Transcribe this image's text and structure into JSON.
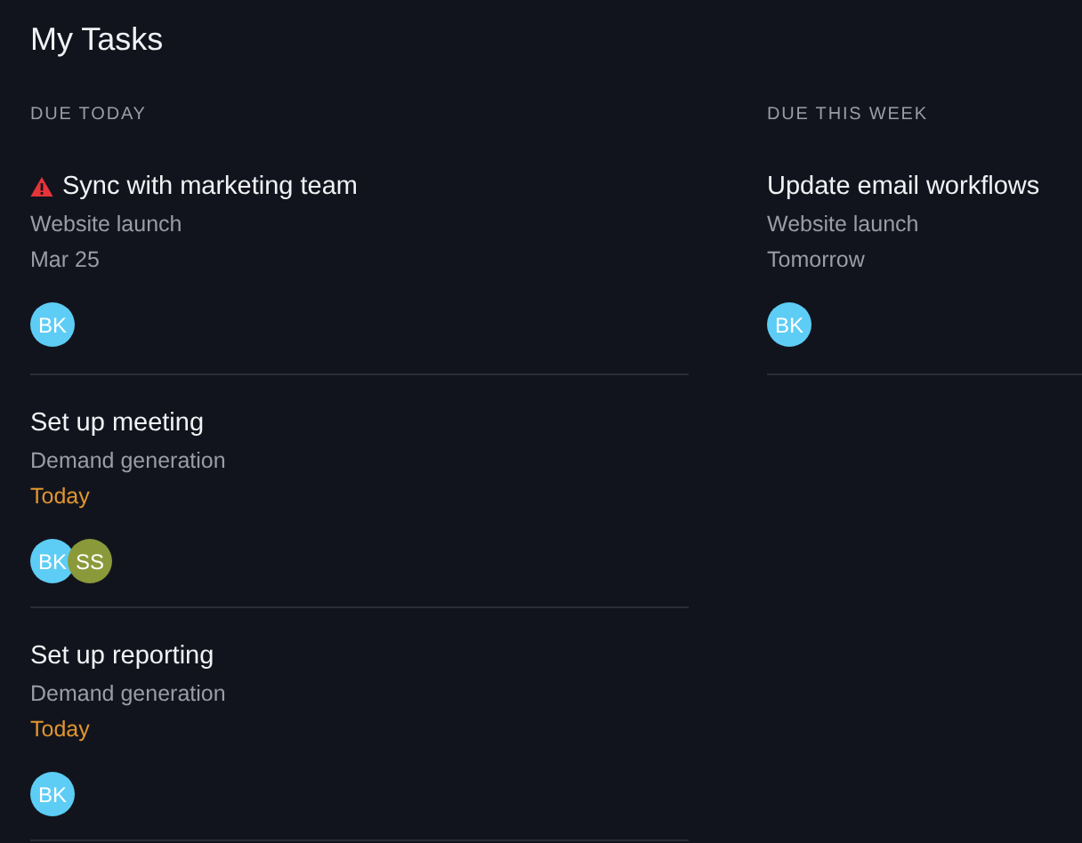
{
  "title": "My Tasks",
  "sections": [
    {
      "heading": "DUE TODAY",
      "tasks": [
        {
          "title": "Sync with marketing team",
          "warning": true,
          "project": "Website launch",
          "due": "Mar 25",
          "due_today": false,
          "assignees": [
            {
              "initials": "BK",
              "color": "#5dcdf5"
            }
          ]
        },
        {
          "title": "Set up meeting",
          "warning": false,
          "project": "Demand generation",
          "due": "Today",
          "due_today": true,
          "assignees": [
            {
              "initials": "BK",
              "color": "#5dcdf5"
            },
            {
              "initials": "SS",
              "color": "#8a9a3a"
            }
          ]
        },
        {
          "title": "Set up reporting",
          "warning": false,
          "project": "Demand generation",
          "due": "Today",
          "due_today": true,
          "assignees": [
            {
              "initials": "BK",
              "color": "#5dcdf5"
            }
          ]
        }
      ]
    },
    {
      "heading": "DUE THIS WEEK",
      "tasks": [
        {
          "title": "Update email workflows",
          "warning": false,
          "project": "Website launch",
          "due": "Tomorrow",
          "due_today": false,
          "assignees": [
            {
              "initials": "BK",
              "color": "#5dcdf5"
            }
          ]
        }
      ]
    }
  ]
}
